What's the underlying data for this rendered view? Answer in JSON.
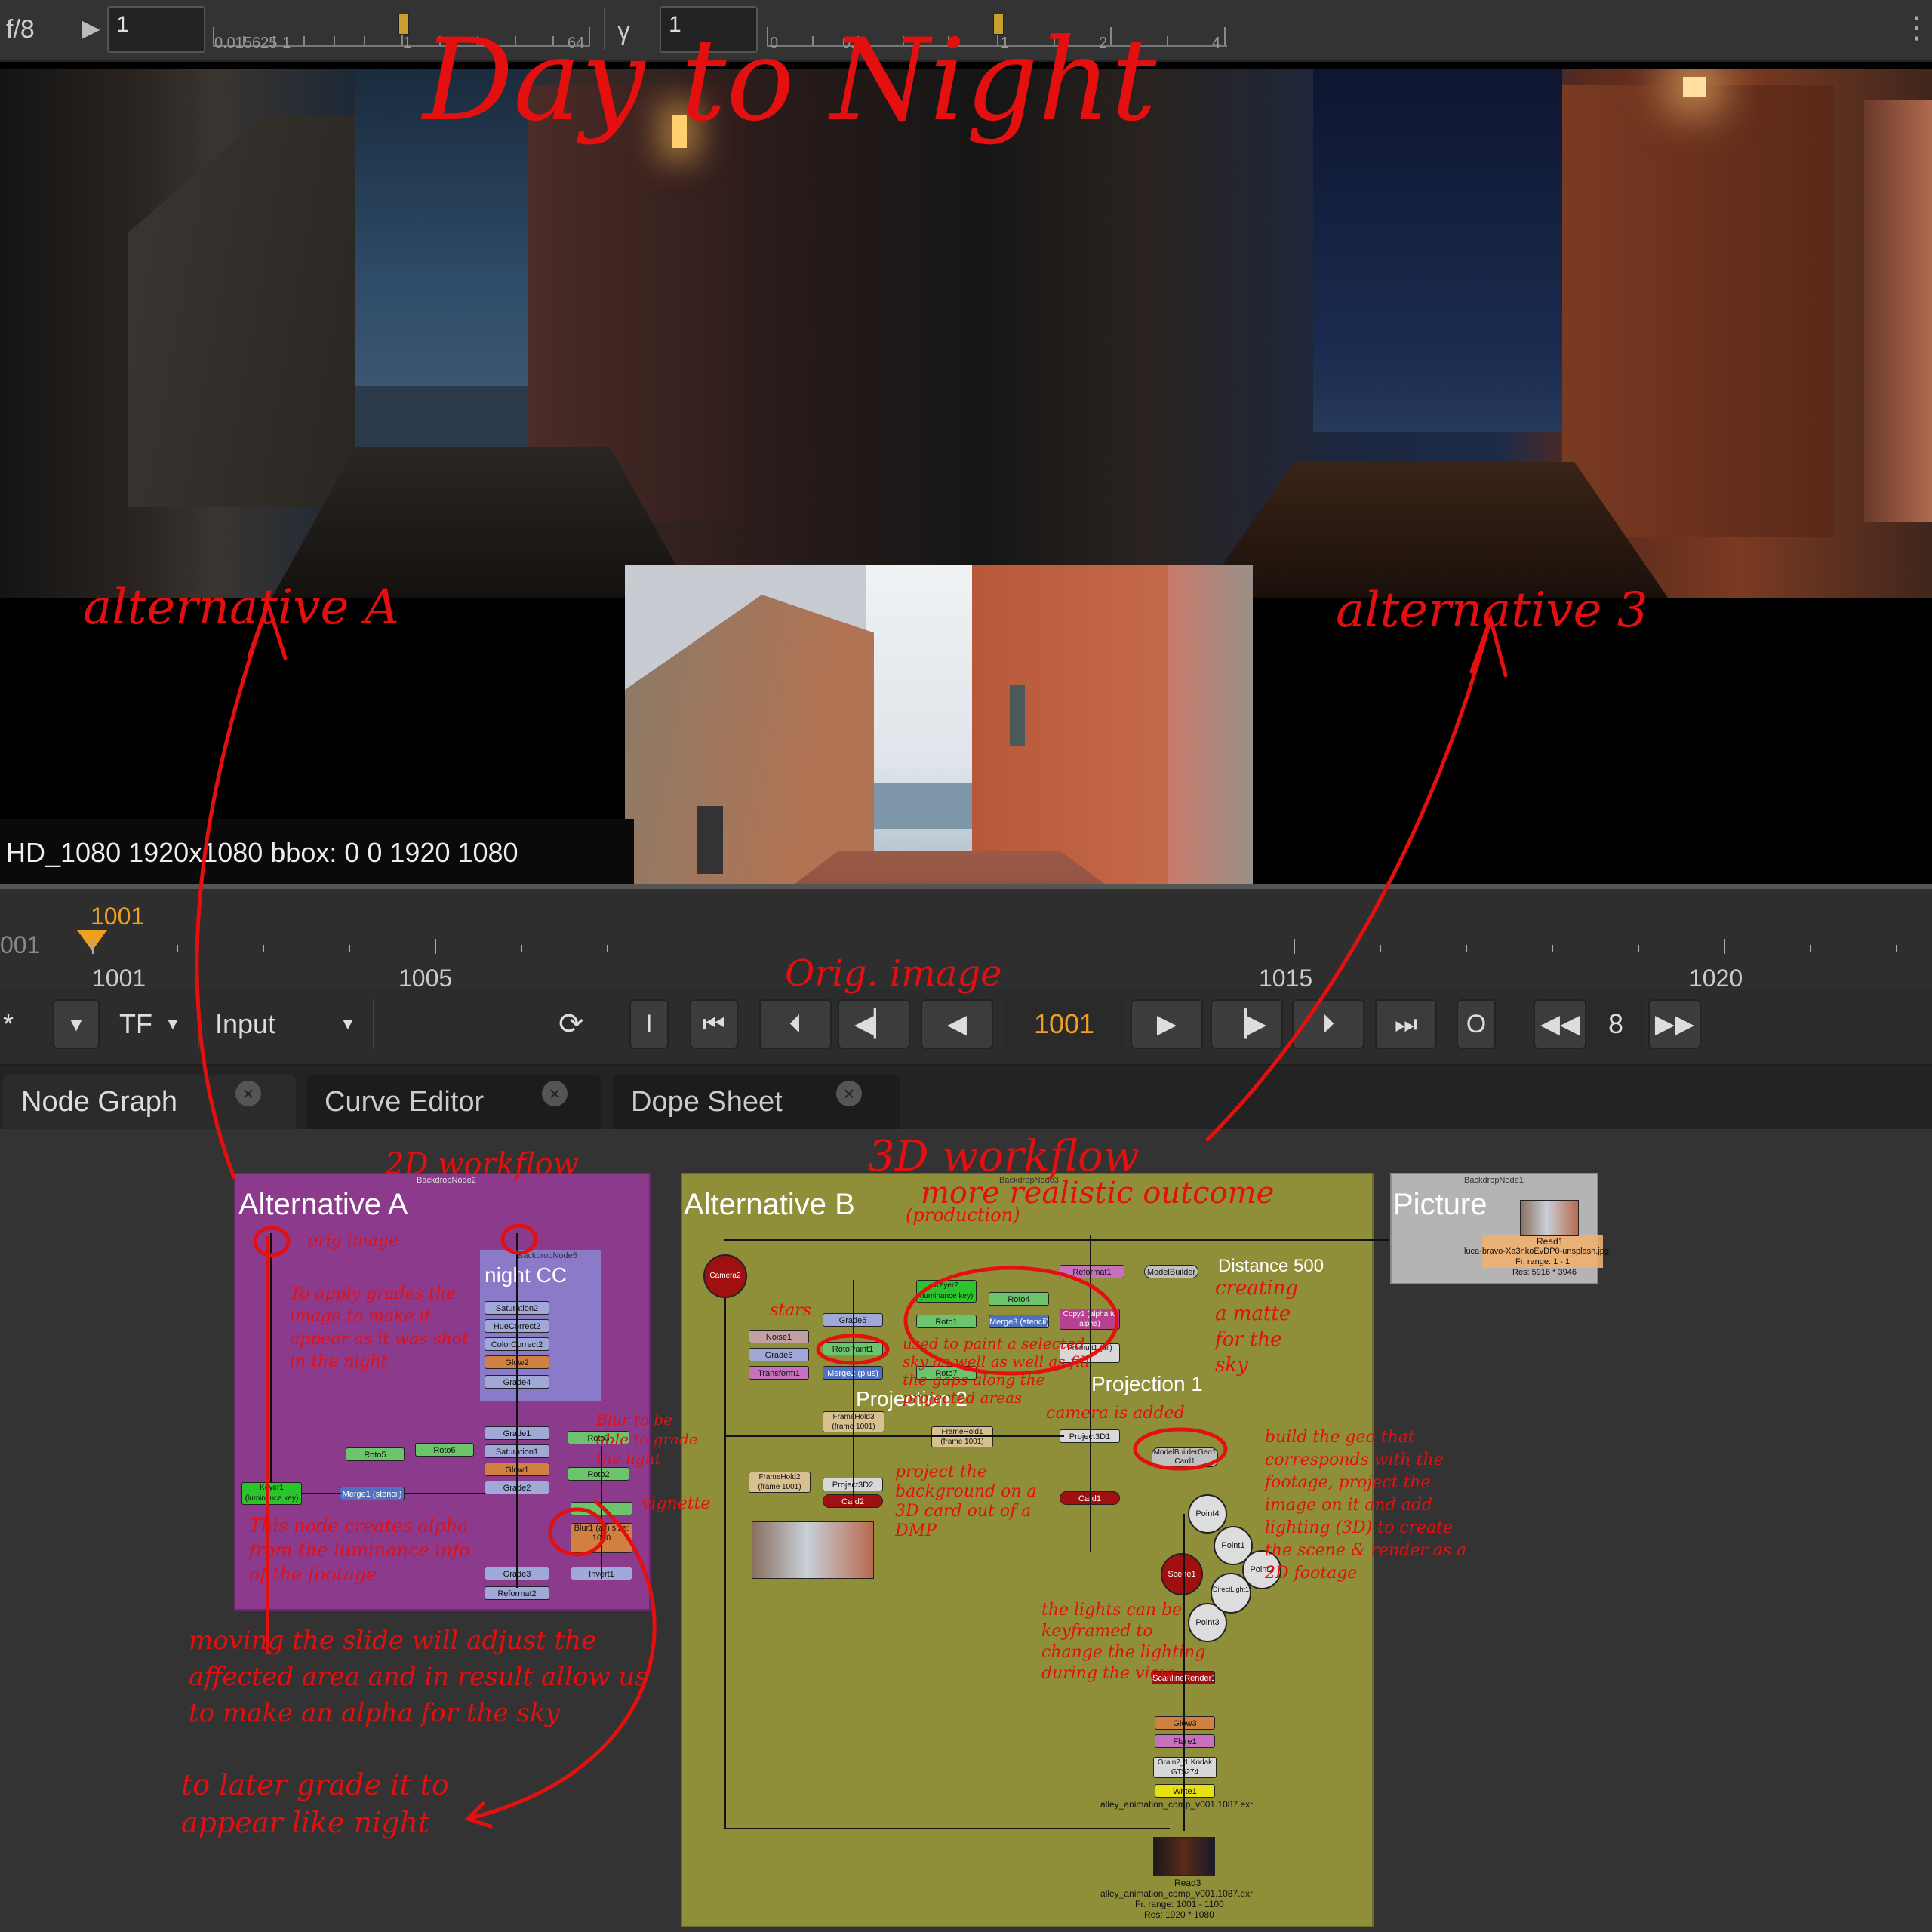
{
  "toolbar": {
    "fstop": "f/8",
    "gain_value": "1",
    "gain_min": "0.015625",
    "gain_min_b": "1",
    "gain_mid": "1",
    "gain_max": "64",
    "gamma_label": "γ",
    "gamma_value": "1",
    "gamma_ticks": [
      "0",
      "0.1",
      "1",
      "2",
      "4"
    ]
  },
  "annotations": {
    "title": "Day to Night",
    "alt_a": "alternative A",
    "alt_b": "alternative 3",
    "orig": "Orig. image",
    "wf2d": "2D workflow",
    "wf3d": "3D workflow",
    "wf3d_sub": "more realistic outcome",
    "wf3d_sub2": "(production)",
    "orig_img_note": "orig image",
    "grade_note": "To apply grades the image to make it appear as it was shot in the night",
    "keyer_note": "This node creates alpha from the luminance info of the footage",
    "slider_note": "moving the slide will adjust the affected area and in result allow us to make an alpha for the sky",
    "slider_note2": "to later grade it to appear like night",
    "blur_note": "Blur to be able to grade the light",
    "vignette_note": "vignette",
    "matte_note": "creating a matte for the sky",
    "stars_note": "stars",
    "roto_note": "used to paint a selected sky as well as well as fill the gaps along the projected areas",
    "cam_note": "camera is added",
    "proj_note": "project the background on a 3D card out of a DMP",
    "geo_note": "build the geo that corresponds with the footage, project the image on it and add lighting (3D) to create the scene & render as a 2D footage",
    "lights_note": "the lights can be keyframed to change the lighting during the view"
  },
  "viewer": {
    "format": "HD_1080 1920x1080  bbox: 0 0 1920 1080"
  },
  "timeline": {
    "current_frame": "1001",
    "left_cut": "001",
    "ticks": [
      "1001",
      "1005",
      "1015",
      "1020"
    ]
  },
  "transport": {
    "star": "*",
    "tf": "TF",
    "input": "Input",
    "frame": "1001",
    "in_btn": "I",
    "out_btn": "O",
    "step": "8"
  },
  "tabs": [
    {
      "label": "Node Graph"
    },
    {
      "label": "Curve Editor"
    },
    {
      "label": "Dope Sheet"
    }
  ],
  "graph": {
    "alt_a_title": "Alternative A",
    "alt_b_title": "Alternative B",
    "picture_title": "Picture",
    "night_cc": "night CC",
    "proj2": "Projection 2",
    "proj1": "Projection 1",
    "distance": "Distance 500",
    "backdrop5": "BackdropNode5",
    "backdrop2": "BackdropNode2",
    "backdrop1": "BackdropNode1",
    "backdrop3": "BackdropNode3",
    "read1": "Read1",
    "read1_file": "luca-bravo-Xa3nkoEvDP0-unsplash.jpg",
    "read1_range": "Fr. range: 1 - 1",
    "read1_res": "Res: 5916 * 3946",
    "write1_file": "alley_animation_comp_v001.1087.exr",
    "read3": "Read3",
    "read3_file": "alley_animation_comp_v001.1087.exr",
    "read3_range": "Fr. range: 1001 - 1100",
    "read3_res": "Res: 1920 * 1080",
    "nodes_a": [
      "Saturation2",
      "HueCorrect2",
      "ColorCorrect2",
      "Glow2",
      "Grade4",
      "Grade1",
      "Saturation1",
      "Glow1",
      "Grade2",
      "Roto5",
      "Roto6",
      "Roto3",
      "Roto2",
      "Blur1 (all) size: 1000",
      "Invert1",
      "Grade3",
      "Reformat2",
      "Keyer1 (luminance key) (alpha)",
      "Merge1 (stencil)"
    ],
    "nodes_b": [
      "Camera2",
      "Reformat1",
      "ModelBuilder",
      "Keyer2 (luminance key) (alpha)",
      "Roto4",
      "Roto1",
      "Merge3 (stencil)",
      "Copy1 (alpha to alpha)",
      "Premult1 (all)",
      "Grade5",
      "Noise1",
      "Grade6",
      "Transform1",
      "RotoPaint1",
      "Merge2 (plus)",
      "Roto7",
      "FrameHold3 (frame 1001)",
      "FrameHold1 (frame 1001)",
      "Project3D1",
      "FrameHold2 (frame 1001)",
      "Project3D2",
      "Card2",
      "Card1",
      "ModelBuilderGeo1 Card1",
      "Point4",
      "Point1",
      "Point2",
      "Point3",
      "DirectLight1",
      "Scene1",
      "ScanlineRender1",
      "Glow3",
      "Flare1",
      "Grain2_1 Kodak GT5274",
      "Write1"
    ]
  },
  "colors": {
    "alt_a_bg": "#8c3a8c",
    "alt_b_bg": "#8f8f3a",
    "picture_bg": "#b4b4b4",
    "annotation": "#e41010",
    "frame_orange": "#f0a020"
  }
}
